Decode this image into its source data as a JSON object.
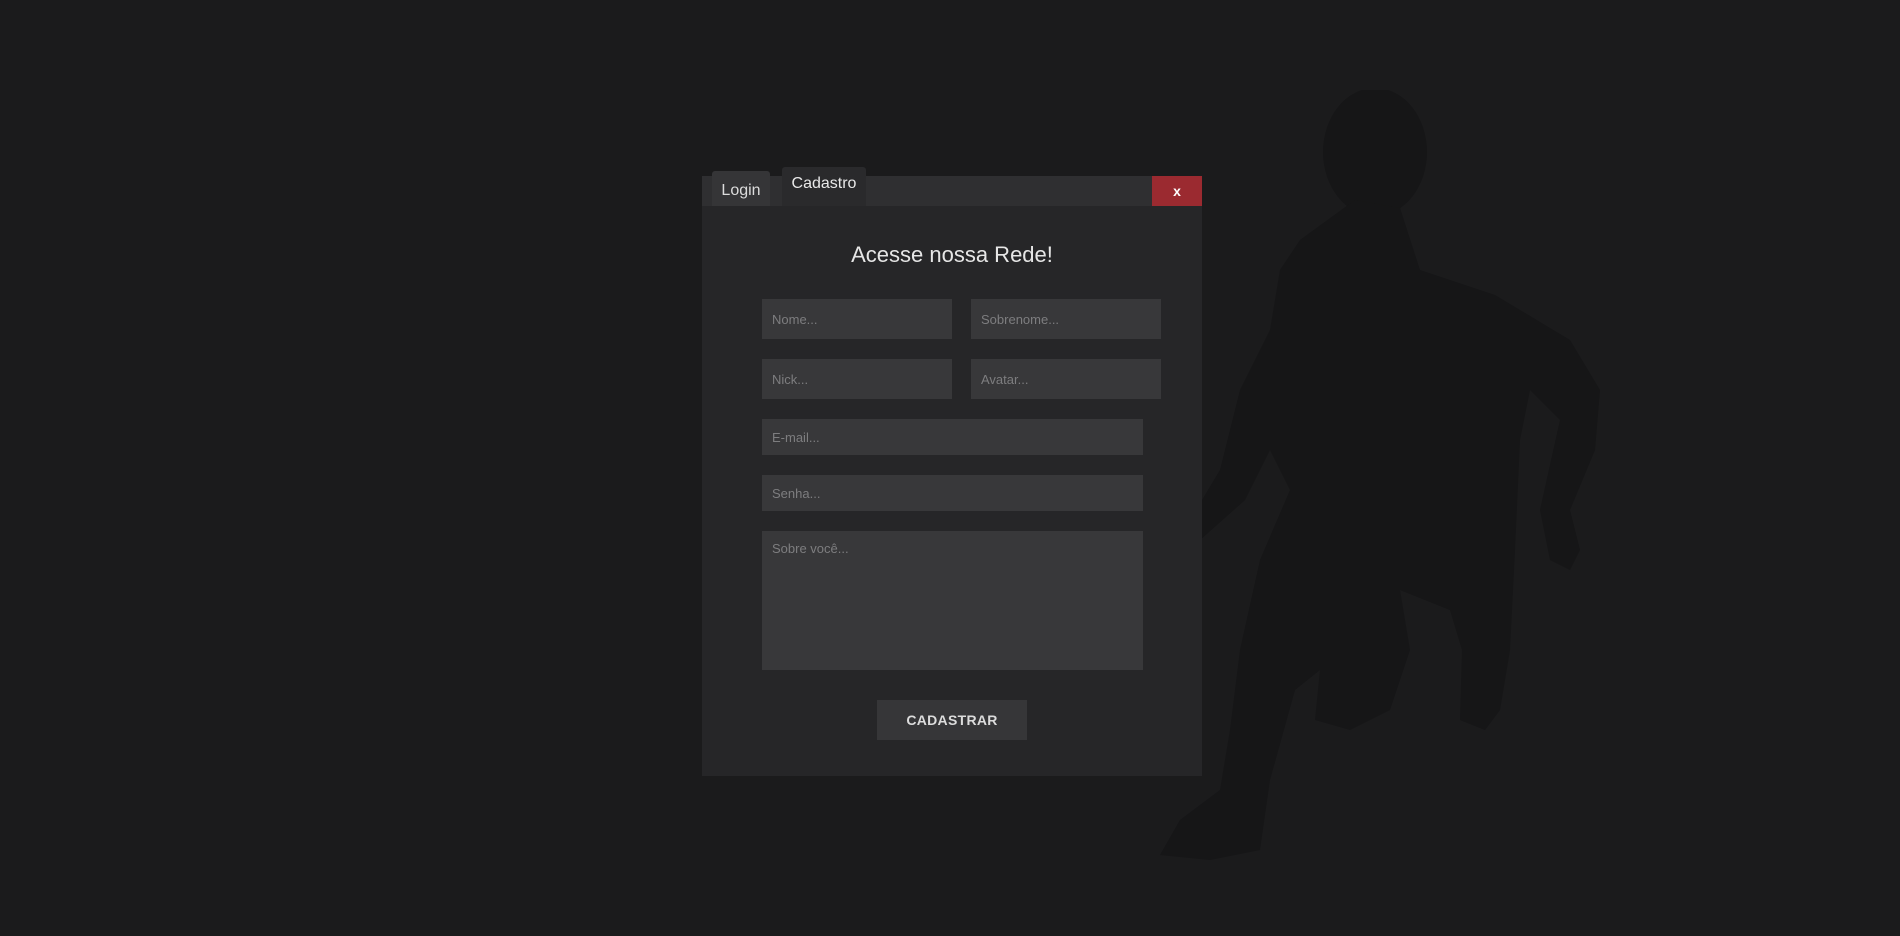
{
  "tabs": {
    "login_label": "Login",
    "cadastro_label": "Cadastro"
  },
  "close_label": "x",
  "form": {
    "title": "Acesse nossa Rede!",
    "nome_placeholder": "Nome...",
    "sobrenome_placeholder": "Sobrenome...",
    "nick_placeholder": "Nick...",
    "avatar_placeholder": "Avatar...",
    "email_placeholder": "E-mail...",
    "senha_placeholder": "Senha...",
    "sobre_placeholder": "Sobre você...",
    "submit_label": "CADASTRAR"
  },
  "colors": {
    "background": "#1b1b1c",
    "panel": "#262628",
    "close_button": "#9b2a30",
    "input": "#38383a"
  },
  "icons": {
    "background_figure": "person-silhouette-icon"
  }
}
